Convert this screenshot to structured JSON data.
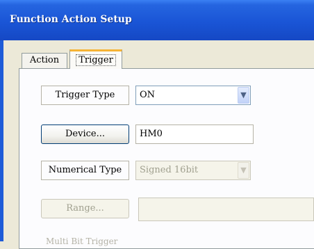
{
  "window": {
    "title": "Function Action Setup"
  },
  "tabs": [
    {
      "label": "Action",
      "selected": false
    },
    {
      "label": "Trigger",
      "selected": true
    }
  ],
  "trigger_type": {
    "label": "Trigger Type",
    "value": "ON"
  },
  "device": {
    "button_label": "Device...",
    "value": "HM0"
  },
  "numerical_type": {
    "label": "Numerical Type",
    "value": "Signed 16bit",
    "enabled": false
  },
  "range": {
    "button_label": "Range...",
    "value": "",
    "enabled": false
  },
  "multi_bit_trigger": {
    "label": "Multi Bit Trigger"
  },
  "icons": {
    "dropdown": "chevron-down-icon"
  },
  "colors": {
    "titlebar": "#2565e0",
    "tab_highlight": "#f6b335",
    "dialog_bg": "#ece9d8"
  }
}
